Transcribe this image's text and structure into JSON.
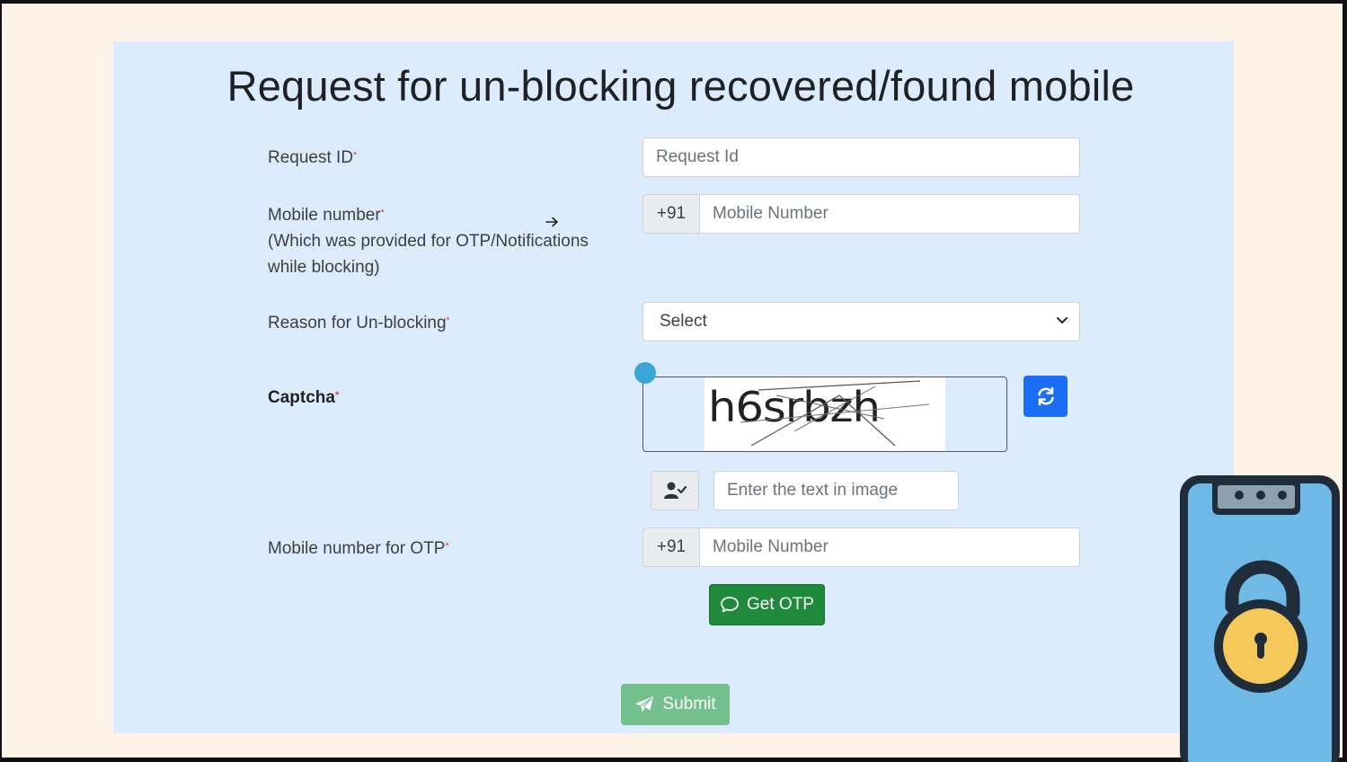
{
  "page": {
    "title": "Request for un-blocking recovered/found mobile"
  },
  "form": {
    "request_id": {
      "label": "Request ID",
      "required_mark": "*",
      "placeholder": "Request Id"
    },
    "mobile_number": {
      "label": "Mobile number",
      "required_mark": "*",
      "note_line1": "(Which was provided for OTP/Notifications",
      "note_line2": "while blocking)",
      "prefix": "+91",
      "placeholder": "Mobile Number"
    },
    "reason": {
      "label": "Reason for Un-blocking",
      "required_mark": "*",
      "selected": "Select"
    },
    "captcha": {
      "label": "Captcha",
      "required_mark": "*",
      "image_text": "h6srbzh",
      "input_placeholder": "Enter the text in image"
    },
    "otp_mobile": {
      "label": "Mobile number for OTP",
      "required_mark": "*",
      "prefix": "+91",
      "placeholder": "Mobile Number"
    },
    "get_otp_label": "Get OTP",
    "submit_label": "Submit"
  },
  "icons": {
    "refresh": "refresh-icon",
    "user_check": "user-check-icon",
    "otp": "chat-bubble-icon",
    "submit": "paper-plane-icon",
    "select": "chevron-down-icon",
    "decor": "unlocked-phone-icon"
  },
  "colors": {
    "card_bg": "#ddecfc",
    "page_bg": "#fdf3e6",
    "primary": "#1a6ef5",
    "success": "#1f8a3b",
    "submit_disabled": "#73c08c",
    "required": "#e0453a"
  }
}
